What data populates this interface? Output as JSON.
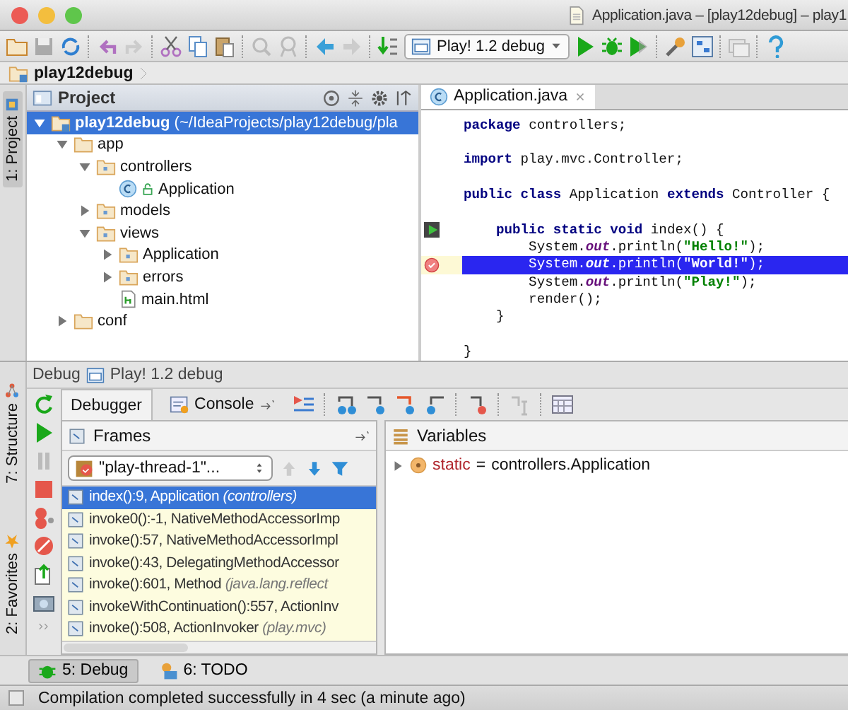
{
  "window": {
    "title": "Application.java – [play12debug] – play1"
  },
  "toolbar": {
    "run_config": "Play! 1.2 debug"
  },
  "breadcrumb": {
    "items": [
      "play12debug"
    ]
  },
  "left_top_tabs": [
    {
      "label": "1: Project",
      "selected": true
    }
  ],
  "left_bottom_tabs": [
    {
      "label": "7: Structure",
      "selected": false
    },
    {
      "label": "2: Favorites",
      "selected": false
    }
  ],
  "project": {
    "title": "Project",
    "tree": [
      {
        "kind": "project",
        "label": "**play12debug** (~/IdeaProjects/play12debug/pla",
        "selected": true,
        "expanded": true,
        "children": [
          {
            "kind": "folder",
            "label": "app",
            "selected": false,
            "expanded": true,
            "children": [
              {
                "kind": "package",
                "label": "controllers",
                "selected": false,
                "expanded": true,
                "children": [
                  {
                    "kind": "class",
                    "label": "Application",
                    "selected": false
                  }
                ]
              },
              {
                "kind": "package",
                "label": "models",
                "selected": false,
                "expanded": false
              },
              {
                "kind": "package",
                "label": "views",
                "selected": false,
                "expanded": true,
                "children": [
                  {
                    "kind": "package",
                    "label": "Application",
                    "selected": false,
                    "expanded": false
                  },
                  {
                    "kind": "package",
                    "label": "errors",
                    "selected": false,
                    "expanded": false
                  },
                  {
                    "kind": "html",
                    "label": "main.html",
                    "selected": false
                  }
                ]
              }
            ]
          },
          {
            "kind": "folder",
            "label": "conf",
            "selected": false,
            "expanded": false
          }
        ]
      }
    ]
  },
  "editor": {
    "tabs": [
      {
        "label": "Application.java",
        "selected": true
      }
    ],
    "lines": [
      {
        "kind": "code",
        "current": false,
        "breakpoint": false,
        "tokens": [
          {
            "kind": "kw",
            "text": "package"
          },
          {
            "kind": "plain",
            "text": " controllers;"
          }
        ]
      },
      {
        "kind": "blank"
      },
      {
        "kind": "code",
        "current": false,
        "breakpoint": false,
        "tokens": [
          {
            "kind": "kw",
            "text": "import"
          },
          {
            "kind": "plain",
            "text": " play.mvc.Controller;"
          }
        ]
      },
      {
        "kind": "blank"
      },
      {
        "kind": "code",
        "current": false,
        "breakpoint": false,
        "tokens": [
          {
            "kind": "kw",
            "text": "public class"
          },
          {
            "kind": "plain",
            "text": " Application "
          },
          {
            "kind": "kw",
            "text": "extends"
          },
          {
            "kind": "plain",
            "text": " Controller {"
          }
        ]
      },
      {
        "kind": "blank"
      },
      {
        "kind": "code",
        "current": false,
        "breakpoint": false,
        "run_marker": true,
        "tokens": [
          {
            "kind": "kw",
            "text": "    public static void"
          },
          {
            "kind": "plain",
            "text": " index() {"
          }
        ]
      },
      {
        "kind": "code",
        "current": false,
        "breakpoint": false,
        "tokens": [
          {
            "kind": "plain",
            "text": "        System."
          },
          {
            "kind": "field",
            "text": "out"
          },
          {
            "kind": "plain",
            "text": ".println("
          },
          {
            "kind": "str",
            "text": "\"Hello!\""
          },
          {
            "kind": "plain",
            "text": ");"
          }
        ]
      },
      {
        "kind": "code",
        "current": true,
        "breakpoint": true,
        "tokens": [
          {
            "kind": "plain",
            "text": "        System."
          },
          {
            "kind": "field",
            "text": "out"
          },
          {
            "kind": "plain",
            "text": ".println("
          },
          {
            "kind": "str",
            "text": "\"World!\""
          },
          {
            "kind": "plain",
            "text": ");"
          }
        ]
      },
      {
        "kind": "code",
        "current": false,
        "breakpoint": false,
        "tokens": [
          {
            "kind": "plain",
            "text": "        System."
          },
          {
            "kind": "field",
            "text": "out"
          },
          {
            "kind": "plain",
            "text": ".println("
          },
          {
            "kind": "str",
            "text": "\"Play!\""
          },
          {
            "kind": "plain",
            "text": ");"
          }
        ]
      },
      {
        "kind": "code",
        "current": false,
        "breakpoint": false,
        "tokens": [
          {
            "kind": "plain",
            "text": "        render();"
          }
        ]
      },
      {
        "kind": "code",
        "current": false,
        "breakpoint": false,
        "tokens": [
          {
            "kind": "plain",
            "text": "    }"
          }
        ]
      },
      {
        "kind": "blank"
      },
      {
        "kind": "code",
        "current": false,
        "breakpoint": false,
        "tokens": [
          {
            "kind": "plain",
            "text": "}"
          }
        ]
      }
    ]
  },
  "debug": {
    "title": "Debug",
    "config": "Play! 1.2 debug",
    "tabs": [
      {
        "label": "Debugger",
        "selected": true
      },
      {
        "label": "Console",
        "selected": false
      }
    ],
    "frames": {
      "title": "Frames",
      "thread": "\"play-thread-1\"...",
      "items": [
        {
          "label": "index():9, Application *(controllers)*",
          "selected": true
        },
        {
          "label": "invoke0():-1, NativeMethodAccessorImp",
          "selected": false
        },
        {
          "label": "invoke():57, NativeMethodAccessorImpl",
          "selected": false
        },
        {
          "label": "invoke():43, DelegatingMethodAccessor",
          "selected": false
        },
        {
          "label": "invoke():601, Method *(java.lang.reflect*",
          "selected": false
        },
        {
          "label": "invokeWithContinuation():557, ActionInv",
          "selected": false
        },
        {
          "label": "invoke():508, ActionInvoker *(play.mvc)*",
          "selected": false
        }
      ]
    },
    "variables": {
      "title": "Variables",
      "items": [
        {
          "name": "static",
          "separator": "=",
          "value": "controllers.Application",
          "expanded": false
        }
      ]
    }
  },
  "tool_buttons": [
    {
      "label": "5: Debug",
      "selected": true
    },
    {
      "label": "6: TODO",
      "selected": false
    }
  ],
  "status_bar": {
    "text": "Compilation completed successfully in 4 sec (a minute ago)"
  }
}
